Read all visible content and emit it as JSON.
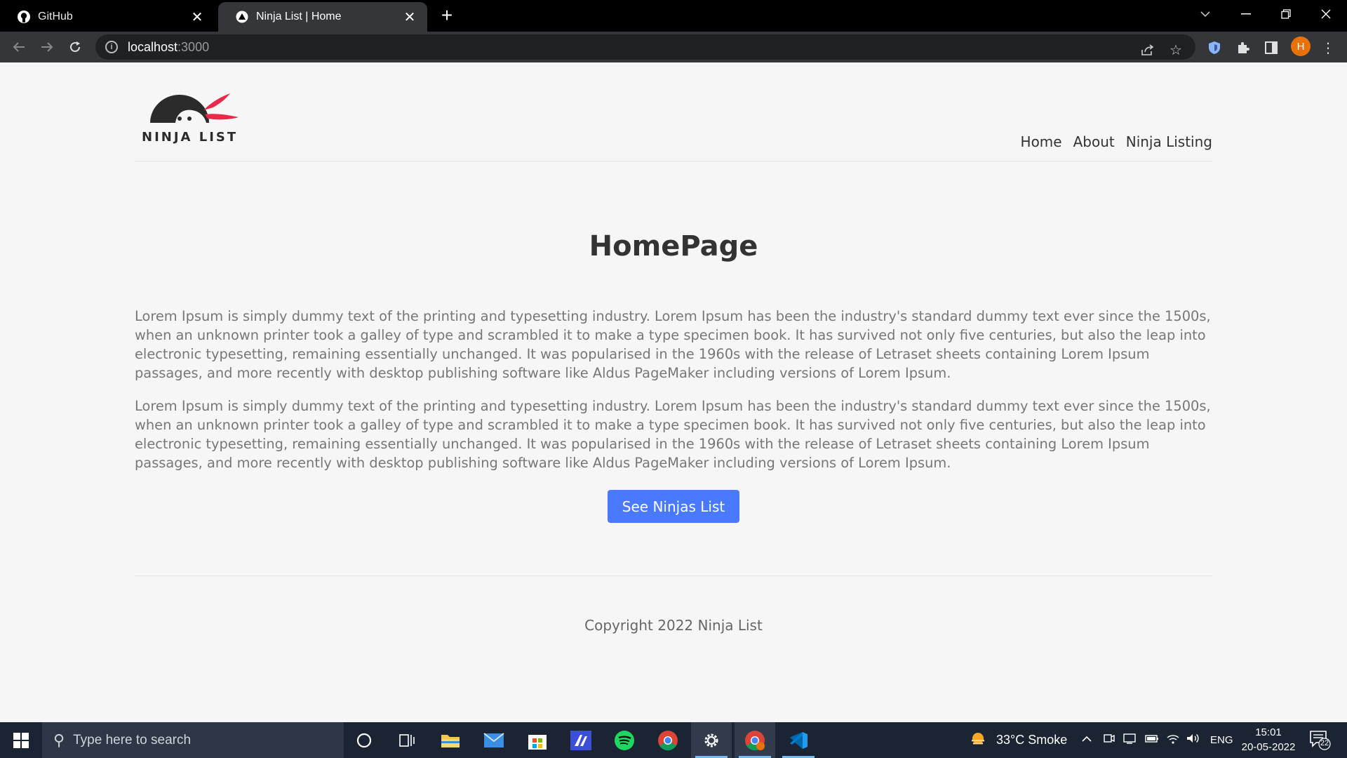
{
  "browser": {
    "tabs": [
      {
        "title": "GitHub",
        "icon": "github-icon"
      },
      {
        "title": "Ninja List | Home",
        "icon": "nextjs-icon"
      }
    ],
    "close_glyph": "✕",
    "new_tab_glyph": "+",
    "url_host": "localhost",
    "url_port": ":3000",
    "profile_initial": "H"
  },
  "site": {
    "logo_text": "NINJA LIST",
    "nav": [
      "Home",
      "About",
      "Ninja Listing"
    ],
    "title": "HomePage",
    "paragraphs": [
      "Lorem Ipsum is simply dummy text of the printing and typesetting industry. Lorem Ipsum has been the industry's standard dummy text ever since the 1500s, when an unknown printer took a galley of type and scrambled it to make a type specimen book. It has survived not only five centuries, but also the leap into electronic typesetting, remaining essentially unchanged. It was popularised in the 1960s with the release of Letraset sheets containing Lorem Ipsum passages, and more recently with desktop publishing software like Aldus PageMaker including versions of Lorem Ipsum.",
      "Lorem Ipsum is simply dummy text of the printing and typesetting industry. Lorem Ipsum has been the industry's standard dummy text ever since the 1500s, when an unknown printer took a galley of type and scrambled it to make a type specimen book. It has survived not only five centuries, but also the leap into electronic typesetting, remaining essentially unchanged. It was popularised in the 1960s with the release of Letraset sheets containing Lorem Ipsum passages, and more recently with desktop publishing software like Aldus PageMaker including versions of Lorem Ipsum."
    ],
    "cta_label": "See Ninjas List",
    "copyright": "Copyright 2022 Ninja List",
    "colors": {
      "accent": "#4979ff",
      "logo_red": "#e8294a",
      "logo_dark": "#2b2b2b"
    }
  },
  "taskbar": {
    "search_placeholder": "Type here to search",
    "weather": "33°C  Smoke",
    "language": "ENG",
    "time": "15:01",
    "date": "20-05-2022",
    "notification_count": "22",
    "apps": [
      "cortana-icon",
      "task-view-icon",
      "file-explorer-icon",
      "mail-icon",
      "store-icon",
      "app-icon",
      "spotify-icon",
      "chrome-icon",
      "settings-icon",
      "chrome-profile-icon",
      "vscode-icon"
    ]
  }
}
